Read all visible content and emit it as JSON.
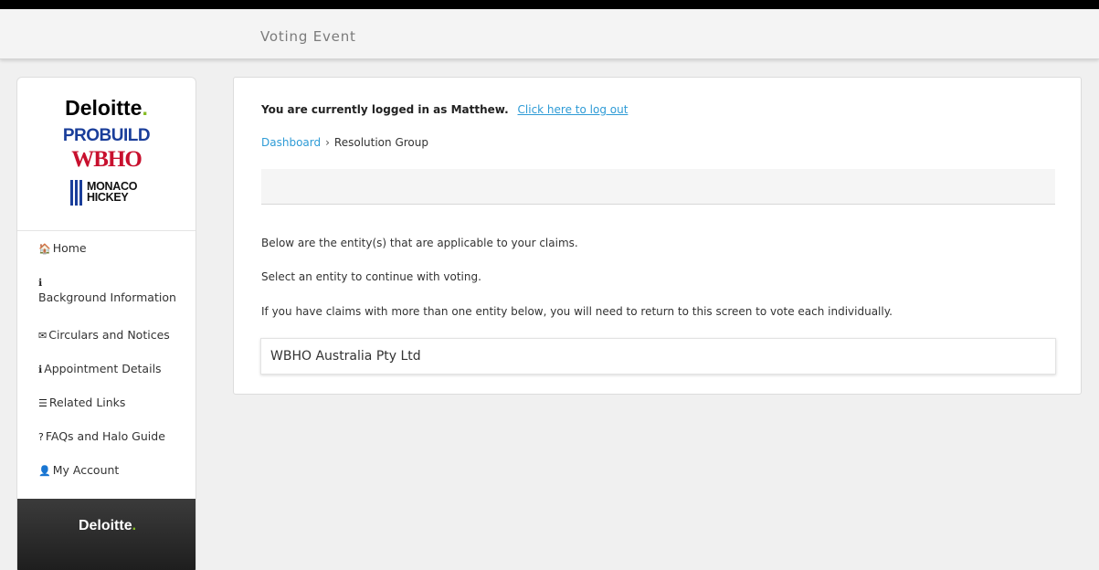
{
  "header": {
    "title": "Voting Event"
  },
  "logos": {
    "deloitte": "Deloitte",
    "deloitte_dot": ".",
    "probuild": "PROBUILD",
    "wbho": "WBHO",
    "monaco_line1": "MONACO",
    "monaco_line2": "HICKEY",
    "footer_deloitte": "Deloitte"
  },
  "sidebar": {
    "items": [
      {
        "icon": "home-icon",
        "glyph": "🏠",
        "label": "Home"
      },
      {
        "icon": "info-icon",
        "glyph": "ℹ",
        "label": "Background Information"
      },
      {
        "icon": "envelope-icon",
        "glyph": "✉",
        "label": "Circulars and Notices"
      },
      {
        "icon": "info-icon",
        "glyph": "ℹ",
        "label": "Appointment Details"
      },
      {
        "icon": "list-icon",
        "glyph": "☰",
        "label": "Related Links"
      },
      {
        "icon": "question-icon",
        "glyph": "?",
        "label": "FAQs and Halo Guide"
      },
      {
        "icon": "user-icon",
        "glyph": "👤",
        "label": "My Account"
      }
    ]
  },
  "main": {
    "login_text": "You are currently logged in as Matthew.",
    "logout_link": "Click here to log out",
    "breadcrumb": {
      "root": "Dashboard",
      "separator": "›",
      "current": "Resolution Group"
    },
    "lines": [
      "Below are the entity(s) that are applicable to your claims.",
      "Select an entity to continue with voting.",
      "If you have claims with more than one entity below, you will need to return to this screen to vote each individually."
    ],
    "entities": [
      "WBHO Australia Pty Ltd"
    ]
  },
  "colors": {
    "link": "#2e9bd6",
    "deloitte_green": "#86bc25",
    "probuild_blue": "#1a3e9a",
    "wbho_red": "#c8102e"
  }
}
